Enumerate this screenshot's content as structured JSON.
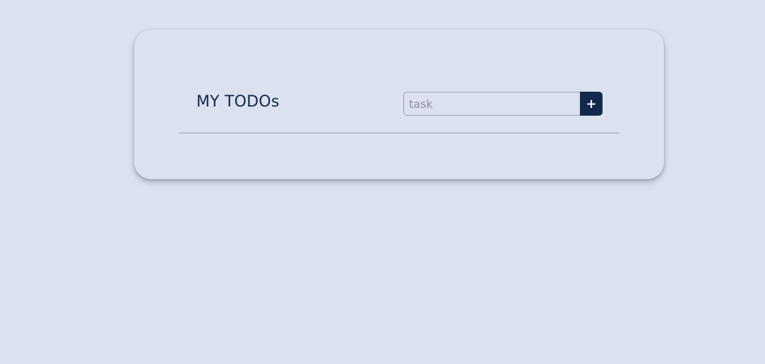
{
  "app": {
    "title": "MY TODOs"
  },
  "task_form": {
    "input_placeholder": "task",
    "input_value": "",
    "add_button_label": "+"
  },
  "todos": [],
  "colors": {
    "background": "#dbe1ee",
    "accent": "#13294b",
    "divider": "#9aa0ab"
  }
}
